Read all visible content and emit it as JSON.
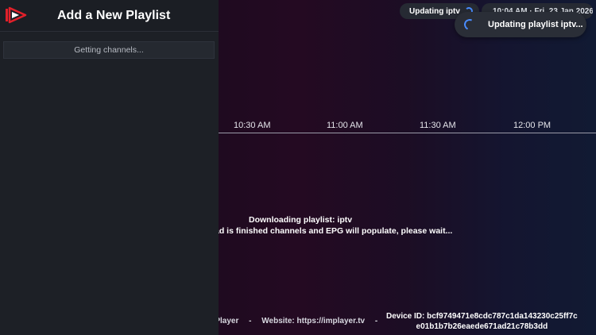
{
  "top_bar": {
    "status_pill": "Updating iptv",
    "clock": "10:04 AM · Fri, 23 Jan 2026"
  },
  "toast": {
    "text": "Updating playlist iptv..."
  },
  "timeline": {
    "ticks": [
      "10:30 AM",
      "11:00 AM",
      "11:30 AM",
      "12:00 PM"
    ]
  },
  "message": {
    "line1": "Downloading playlist: iptv",
    "line2": "ad is finished channels and EPG will populate, please wait..."
  },
  "footer": {
    "app": "MPlayer",
    "sep": "-",
    "website": "Website: https://implayer.tv",
    "device_line1": "Device ID: bcf9749471e8cdc787c1da143230c25ff7c",
    "device_line2": "e01b1b7b26eaede671ad21c78b3dd"
  },
  "panel": {
    "title": "Add a New Playlist",
    "status": "Getting channels..."
  },
  "colors": {
    "accent": "#4a8cff",
    "logo_red": "#e0202a"
  },
  "icons": {
    "logo": "implayer-logo-icon",
    "spinner": "loading-spinner-icon"
  }
}
